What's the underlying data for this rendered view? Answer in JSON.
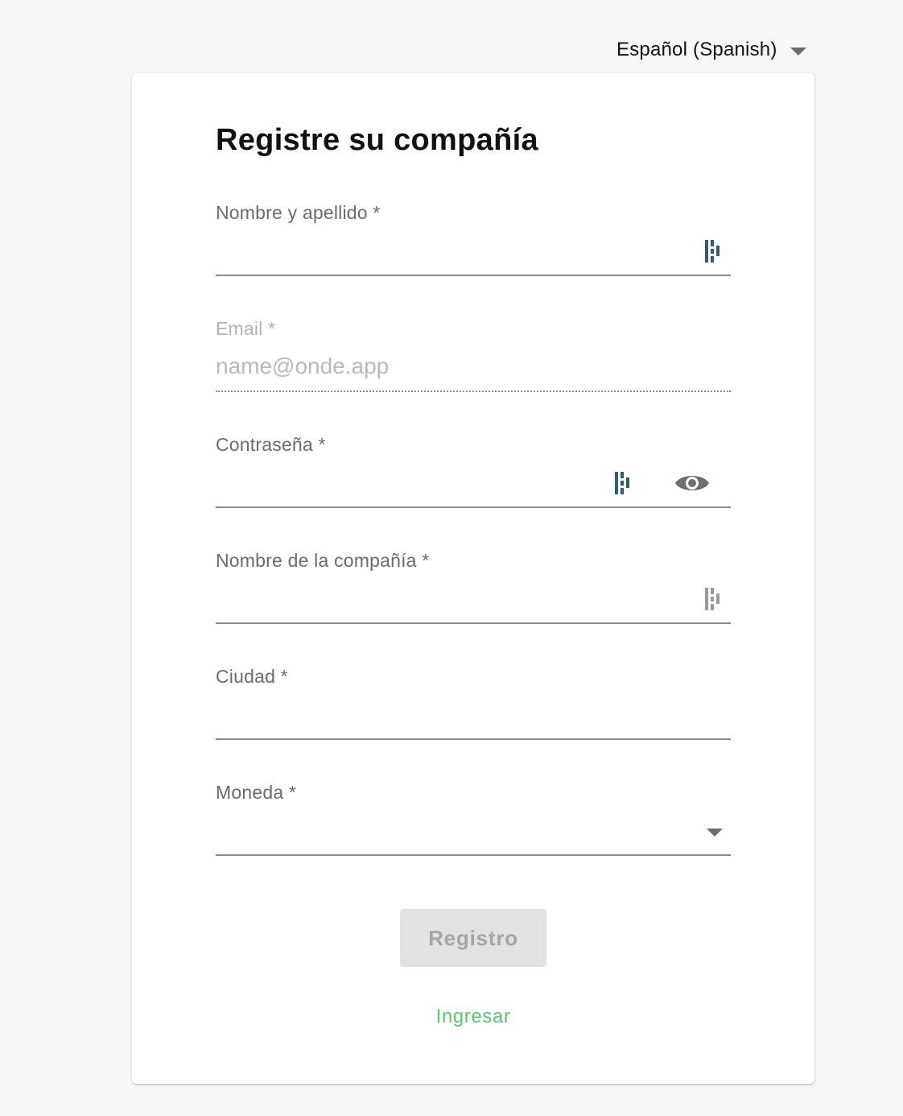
{
  "language_selector": {
    "label": "Español (Spanish)",
    "icon": "chevron-down-icon"
  },
  "form": {
    "title": "Registre su compañía",
    "fields": {
      "full_name": {
        "label": "Nombre y apellido *",
        "value": "",
        "placeholder": ""
      },
      "email": {
        "label": "Email *",
        "value": "",
        "placeholder": "name@onde.app",
        "disabled": true
      },
      "password": {
        "label": "Contraseña *",
        "value": "",
        "placeholder": "",
        "icon": "eye-icon"
      },
      "company_name": {
        "label": "Nombre de la compañía *",
        "value": "",
        "placeholder": ""
      },
      "city": {
        "label": "Ciudad *",
        "value": "",
        "placeholder": ""
      },
      "currency": {
        "label": "Moneda *",
        "value": "",
        "icon": "chevron-down-icon"
      }
    },
    "submit_label": "Registro",
    "login_link": "Ingresar"
  },
  "colors": {
    "background": "#f7f7f7",
    "card": "#ffffff",
    "accent_link": "#57c86a",
    "password_manager_icon": "#2f5d73",
    "button_disabled_bg": "#e2e2e2",
    "button_disabled_text": "#a6a6a6"
  }
}
